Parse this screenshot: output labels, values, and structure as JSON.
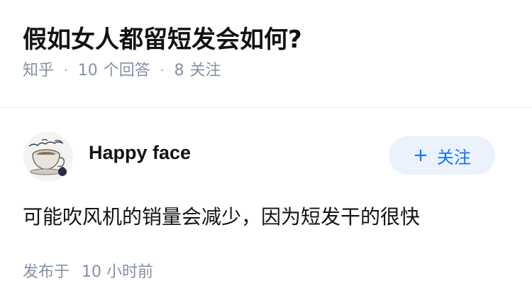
{
  "question": {
    "title": "假如女人都留短发会如何?",
    "meta": {
      "source": "知乎",
      "separator": "·",
      "answers_count": "10",
      "answers_label": "个回答",
      "followers_count": "8",
      "followers_label": "关注"
    }
  },
  "answer": {
    "author": {
      "name": "Happy face",
      "avatar_icon": "teacup-avatar-icon"
    },
    "follow_button": {
      "icon": "+",
      "label": "关注"
    },
    "content": "可能吹风机的销量会减少，因为短发干的很快",
    "published": {
      "label": "发布于",
      "time": "10 小时前"
    }
  },
  "colors": {
    "primary_text": "#121212",
    "secondary_text": "#8590a6",
    "accent_blue": "#1772f6",
    "button_background": "#ebf2fb",
    "divider": "#ebebeb"
  }
}
